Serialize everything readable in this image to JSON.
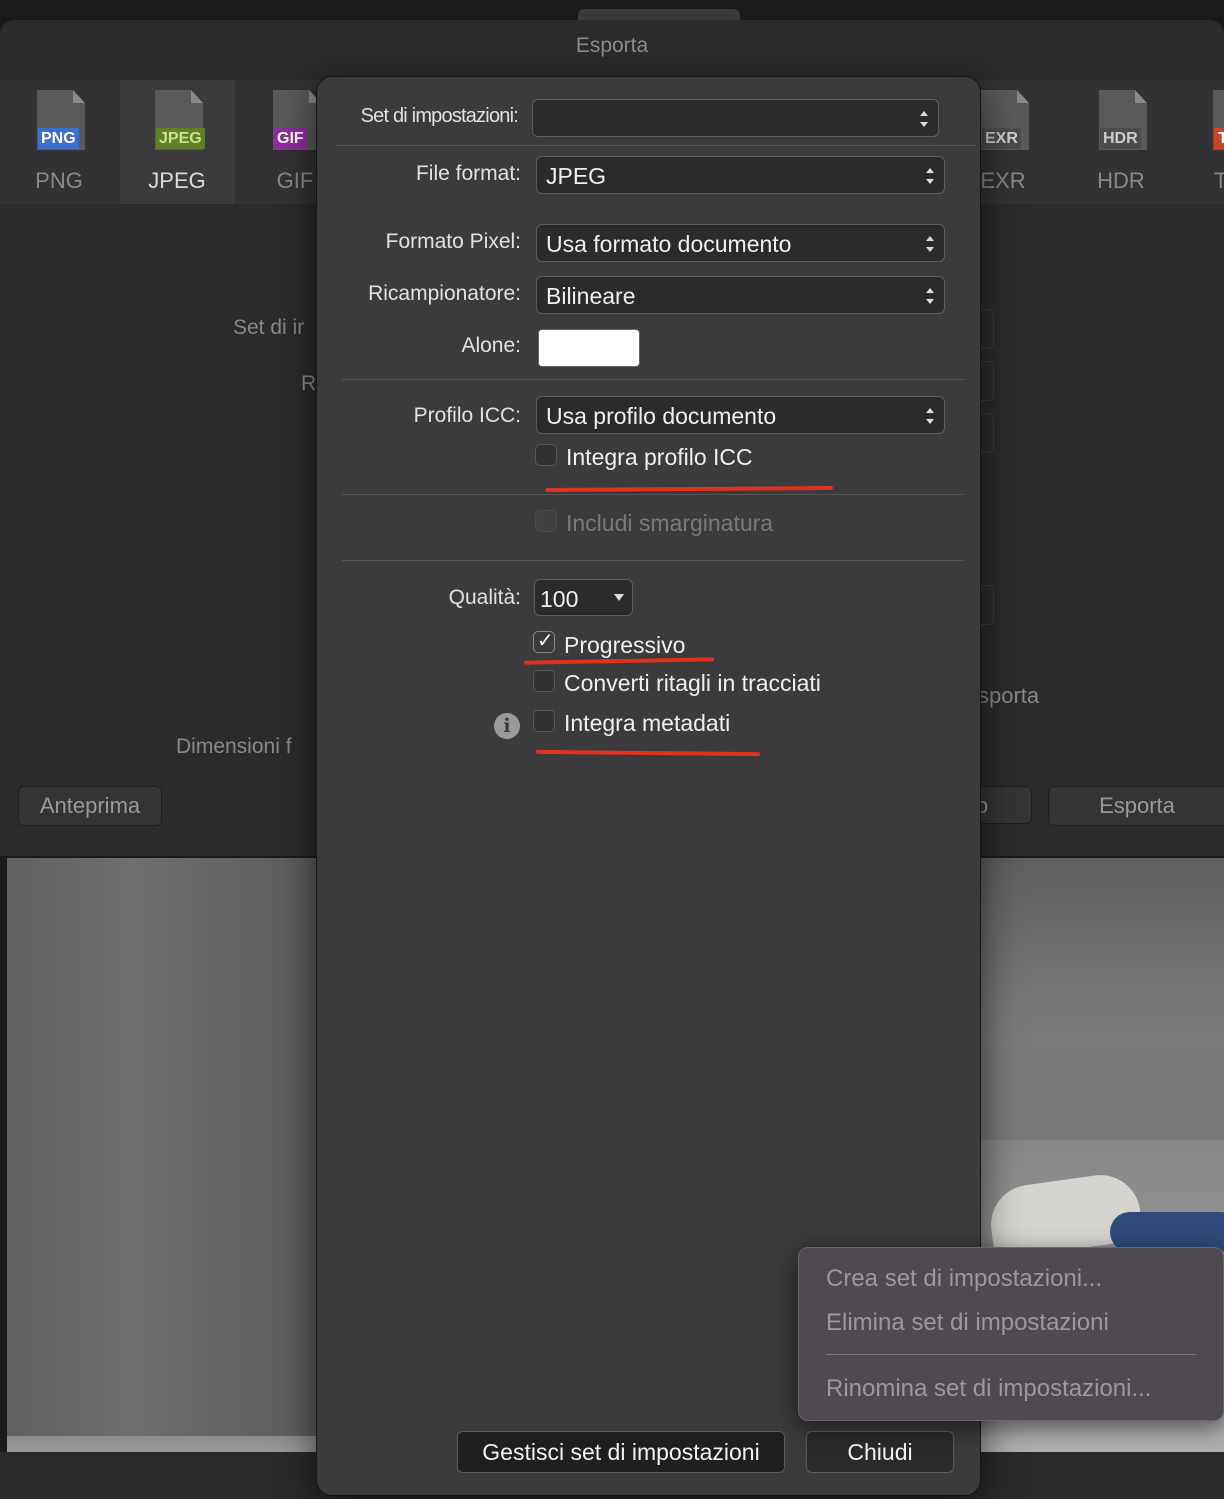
{
  "window": {
    "title": "Esporta"
  },
  "format_tabs": [
    {
      "badge": "PNG",
      "label": "PNG",
      "badge_color": "#3d6fc9"
    },
    {
      "badge": "JPEG",
      "label": "JPEG",
      "badge_color": "#5f7f2a",
      "selected": true
    },
    {
      "badge": "GIF",
      "label": "GIF",
      "badge_color": "#8d2f9a"
    },
    {
      "badge": "EXR",
      "label": "EXR",
      "badge_color": "#4c4c4e"
    },
    {
      "badge": "HDR",
      "label": "HDR",
      "badge_color": "#4c4c4e"
    },
    {
      "badge": "T",
      "label": "T",
      "badge_color": "#c8432a"
    }
  ],
  "background": {
    "preset_label_partial": "Set di ir",
    "resample_label_partial": "R",
    "dimensions_label_partial": "Dimensioni f",
    "export_area_partial": "sporta",
    "right_button_partial": "o",
    "preview_button": "Anteprima",
    "export_button": "Esporta"
  },
  "dialog": {
    "preset": {
      "label": "Set di impostazioni:",
      "value": ""
    },
    "file_format": {
      "label": "File format:",
      "value": "JPEG"
    },
    "pixel_format": {
      "label": "Formato Pixel:",
      "value": "Usa formato documento"
    },
    "resampler": {
      "label": "Ricampionatore:",
      "value": "Bilineare"
    },
    "matte": {
      "label": "Alone:",
      "color": "#ffffff"
    },
    "icc_profile": {
      "label": "Profilo ICC:",
      "value": "Usa profilo documento"
    },
    "embed_icc": {
      "label": "Integra profilo ICC",
      "checked": false
    },
    "include_bleed": {
      "label": "Includi smarginatura",
      "checked": false,
      "disabled": true
    },
    "quality": {
      "label": "Qualità:",
      "value": "100"
    },
    "progressive": {
      "label": "Progressivo",
      "checked": true
    },
    "convert_clips": {
      "label": "Converti ritagli in tracciati",
      "checked": false
    },
    "embed_metadata": {
      "label": "Integra metadati",
      "checked": false
    },
    "info_icon": "info-icon",
    "manage_presets_button": "Gestisci set di impostazioni",
    "close_button": "Chiudi",
    "annotation_color": "#e0321e"
  },
  "context_menu": {
    "items": [
      "Crea set di impostazioni...",
      "Elimina set di impostazioni",
      "Rinomina set di impostazioni..."
    ]
  }
}
